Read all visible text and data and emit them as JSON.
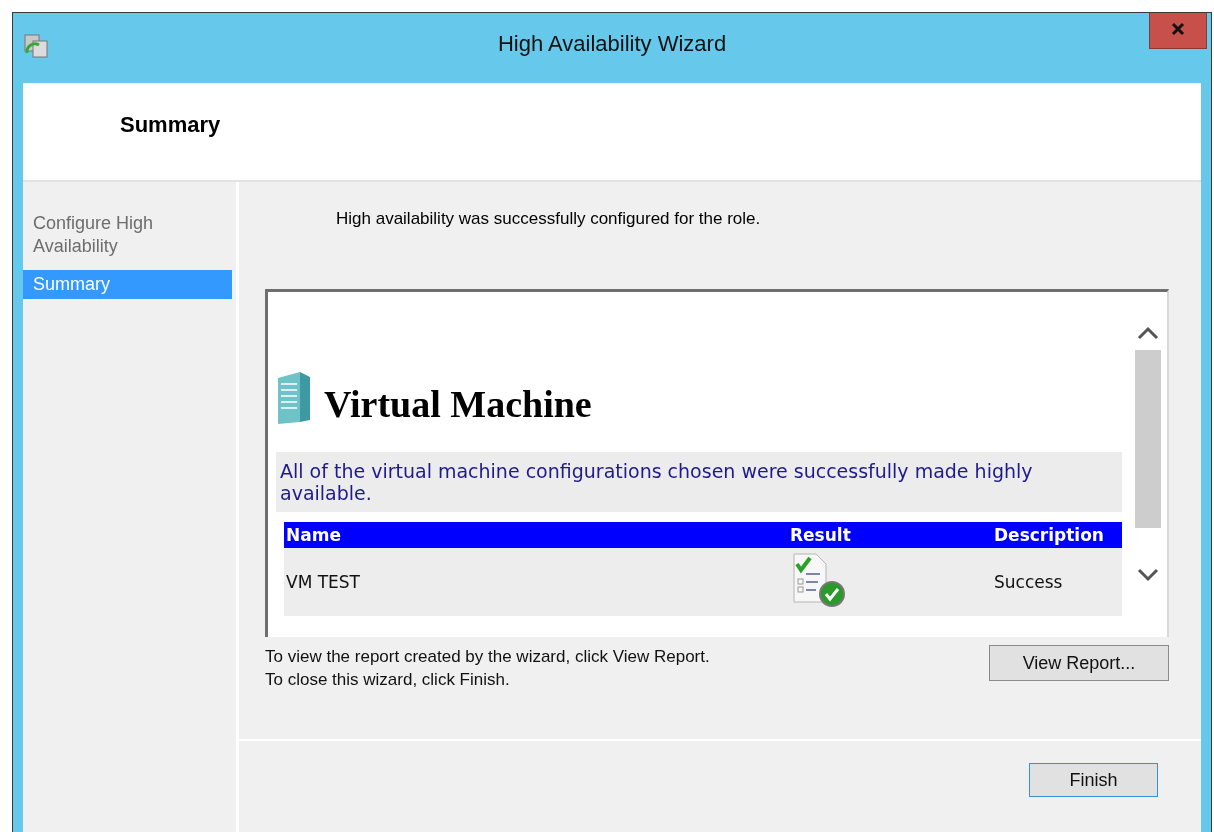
{
  "window": {
    "title": "High Availability Wizard"
  },
  "header": {
    "title": "Summary"
  },
  "steps": [
    {
      "label": "Configure High Availability",
      "selected": false
    },
    {
      "label": "Summary",
      "selected": true
    }
  ],
  "status_message": "High availability was successfully configured for the role.",
  "report": {
    "heading": "Virtual Machine",
    "message": "All of the virtual machine configurations chosen were successfully made highly available.",
    "columns": [
      "Name",
      "Result",
      "Description"
    ],
    "rows": [
      {
        "name": "VM TEST",
        "success": true,
        "description": "Success"
      }
    ]
  },
  "instructions": [
    "To view the report created by the wizard, click View Report.",
    "To close this wizard, click Finish."
  ],
  "view_report_button": "View Report...",
  "finish_button": "Finish"
}
